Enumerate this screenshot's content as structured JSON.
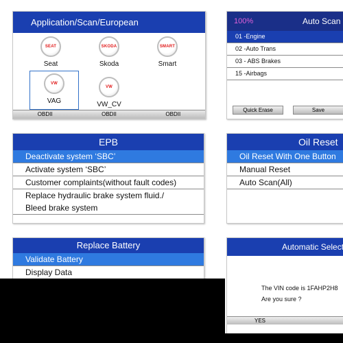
{
  "panel1": {
    "title": "Application/Scan/European",
    "brands": [
      {
        "name": "Seat",
        "logo": "SEAT"
      },
      {
        "name": "Skoda",
        "logo": "SKODA"
      },
      {
        "name": "Smart",
        "logo": "SMART"
      },
      {
        "name": "VAG",
        "logo": "VW"
      },
      {
        "name": "VW_CV",
        "logo": "VW"
      }
    ],
    "tabs": [
      "OBDII",
      "OBDII",
      "OBDII"
    ]
  },
  "panel2": {
    "percent": "100%",
    "title": "Auto Scan",
    "rows": [
      "01 -Engine",
      "02 -Auto Trans",
      "03 - ABS Brakes",
      "15 -Airbags"
    ],
    "buttons": {
      "quick_erase": "Quick Erase",
      "save": "Save"
    }
  },
  "panel3": {
    "title": "EPB",
    "items": [
      "Deactivate system ‘SBC’",
      "Activate system ‘SBC’",
      "Customer complaints(without fault codes)",
      "Replace hydraulic brake system fluid./",
      "Bleed brake system"
    ]
  },
  "panel4": {
    "title": "Oil Reset",
    "items": [
      "Oil Reset With One Button",
      "Manual Reset",
      "Auto Scan(All)"
    ]
  },
  "panel5": {
    "title": "Replace Battery",
    "items": [
      "Validate Battery",
      "Display Data"
    ]
  },
  "panel6": {
    "title": "Automatic Selection",
    "line1": "The VIN code is 1FAHP2H8",
    "line2": "Are you sure ?",
    "yes": "YES"
  },
  "colors": {
    "title_blue": "#1a3fb0",
    "select_blue": "#2f7ae0",
    "logo_red": "#e01818",
    "percent_pink": "#e060d8"
  }
}
